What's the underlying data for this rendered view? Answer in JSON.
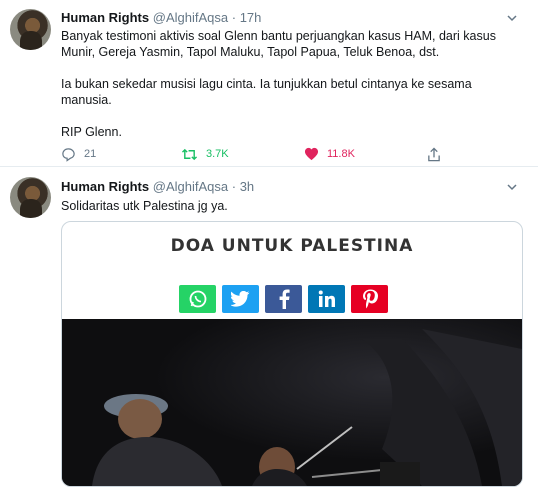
{
  "tweets": [
    {
      "name": "Human Rights",
      "handle": "@AlghifAqsa",
      "separator": "·",
      "time": "17h",
      "paragraphs": [
        "Banyak testimoni aktivis soal Glenn bantu perjuangkan kasus HAM, dari kasus Munir, Gereja Yasmin, Tapol Maluku, Tapol Papua, Teluk Benoa, dst.",
        "Ia bukan sekedar musisi lagu cinta. Ia tunjukkan betul cintanya ke sesama manusia.",
        "RIP Glenn."
      ],
      "actions": {
        "replies": "21",
        "retweets": "3.7K",
        "likes": "11.8K"
      }
    },
    {
      "name": "Human Rights",
      "handle": "@AlghifAqsa",
      "separator": "·",
      "time": "3h",
      "text": "Solidaritas utk Palestina jg ya.",
      "media": {
        "title": "DOA UNTUK PALESTINA",
        "share_buttons": [
          {
            "icon": "whatsapp-icon",
            "color": "#25d366"
          },
          {
            "icon": "twitter-icon",
            "color": "#1da1f2"
          },
          {
            "icon": "facebook-icon",
            "color": "#3b5998"
          },
          {
            "icon": "linkedin-icon",
            "color": "#0077b5"
          },
          {
            "icon": "pinterest-icon",
            "color": "#e60023"
          }
        ]
      }
    }
  ],
  "colors": {
    "retweeted": "#17bf63",
    "liked": "#e0245e",
    "muted": "#657786"
  }
}
